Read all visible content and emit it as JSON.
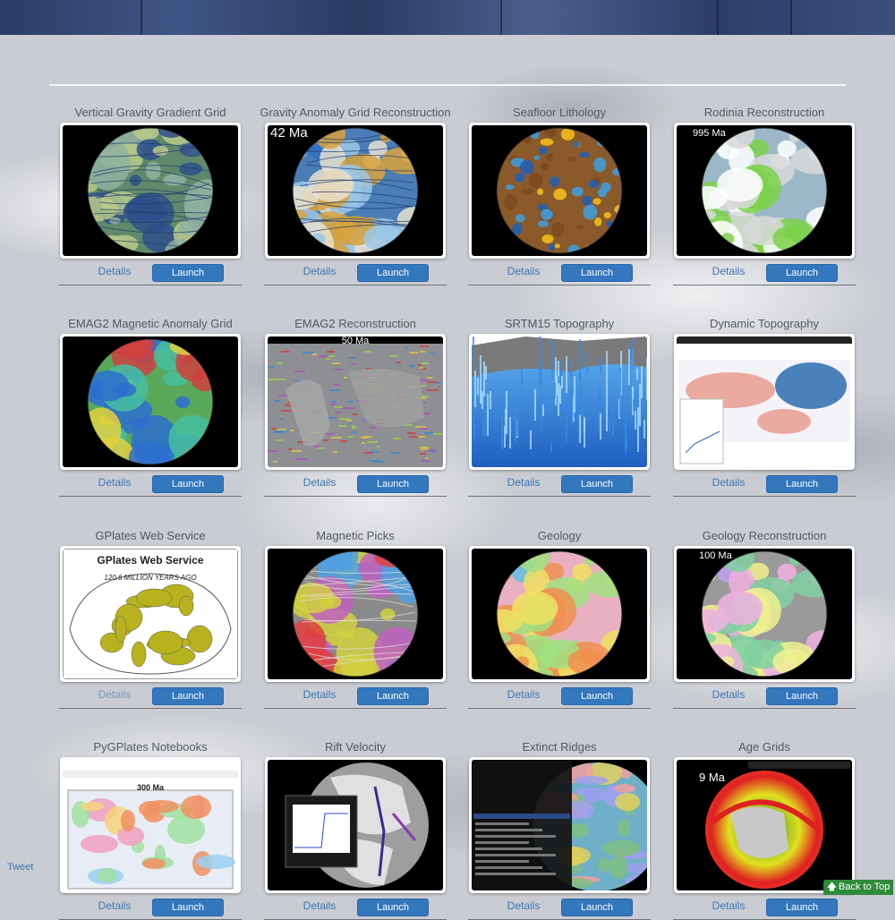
{
  "banner": {
    "tiles": 5
  },
  "cards": [
    {
      "title": "Vertical Gravity Gradient Grid",
      "details": "Details",
      "launch": "Launch",
      "age": "",
      "theme": "gradient"
    },
    {
      "title": "Gravity Anomaly Grid Reconstruction",
      "details": "Details",
      "launch": "Launch",
      "age": "42 Ma",
      "theme": "gravity"
    },
    {
      "title": "Seafloor Lithology",
      "details": "Details",
      "launch": "Launch",
      "age": "",
      "theme": "lithology"
    },
    {
      "title": "Rodinia Reconstruction",
      "details": "Details",
      "launch": "Launch",
      "age": "995 Ma",
      "theme": "rodinia"
    },
    {
      "title": "EMAG2 Magnetic Anomaly Grid",
      "details": "Details",
      "launch": "Launch",
      "age": "",
      "theme": "emag"
    },
    {
      "title": "EMAG2 Reconstruction",
      "details": "Details",
      "launch": "Launch",
      "age": "50 Ma",
      "theme": "emagrec"
    },
    {
      "title": "SRTM15 Topography",
      "details": "Details",
      "launch": "Launch",
      "age": "",
      "theme": "srtm"
    },
    {
      "title": "Dynamic Topography",
      "details": "Details",
      "launch": "Launch",
      "age": "",
      "theme": "dynamic"
    },
    {
      "title": "GPlates Web Service",
      "details": "Details",
      "launch": "Launch",
      "age": "",
      "theme": "gws",
      "heading": "GPlates Web Service",
      "subheading": "120.6 MILLION YEARS AGO",
      "details_visited": true
    },
    {
      "title": "Magnetic Picks",
      "details": "Details",
      "launch": "Launch",
      "age": "",
      "theme": "picks"
    },
    {
      "title": "Geology",
      "details": "Details",
      "launch": "Launch",
      "age": "",
      "theme": "geology"
    },
    {
      "title": "Geology Reconstruction",
      "details": "Details",
      "launch": "Launch",
      "age": "100 Ma",
      "theme": "geologyrec"
    },
    {
      "title": "PyGPlates Notebooks",
      "details": "Details",
      "launch": "Launch",
      "age": "300 Ma",
      "theme": "notebook"
    },
    {
      "title": "Rift Velocity",
      "details": "Details",
      "launch": "Launch",
      "age": "",
      "theme": "rift"
    },
    {
      "title": "Extinct Ridges",
      "details": "Details",
      "launch": "Launch",
      "age": "",
      "theme": "ridges"
    },
    {
      "title": "Age Grids",
      "details": "Details",
      "launch": "Launch",
      "age": "9 Ma",
      "theme": "agegrid"
    }
  ],
  "footer": {
    "tweet": "Tweet",
    "back_to_top": "Back to Top"
  },
  "colors": {
    "link": "#3b78b8",
    "button": "#3377bd",
    "back_to_top": "#2e8b3a"
  }
}
